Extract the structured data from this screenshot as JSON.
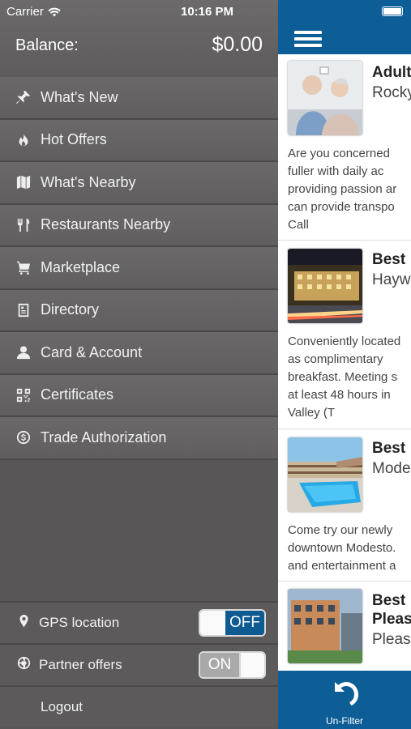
{
  "status_bar": {
    "carrier": "Carrier",
    "time": "10:16 PM"
  },
  "balance": {
    "label": "Balance:",
    "value": "$0.00"
  },
  "menu": {
    "items": [
      {
        "label": "What's New",
        "icon": "pin-icon"
      },
      {
        "label": "Hot Offers",
        "icon": "fire-icon"
      },
      {
        "label": "What's Nearby",
        "icon": "map-icon"
      },
      {
        "label": "Restaurants Nearby",
        "icon": "utensils-icon"
      },
      {
        "label": "Marketplace",
        "icon": "cart-icon"
      },
      {
        "label": "Directory",
        "icon": "directory-icon"
      },
      {
        "label": "Card & Account",
        "icon": "user-icon"
      },
      {
        "label": "Certificates",
        "icon": "qr-icon"
      },
      {
        "label": "Trade Authorization",
        "icon": "dollar-circle-icon"
      }
    ]
  },
  "settings": {
    "gps_label": "GPS location",
    "gps_state": "OFF",
    "partner_label": "Partner offers",
    "partner_state": "ON",
    "logout_label": "Logout"
  },
  "listings": [
    {
      "title": "Adult",
      "subtitle": "Rocky",
      "desc": [
        "Are you concerned",
        "fuller with daily ac",
        "providing passion ar",
        "can provide transpo",
        "Call"
      ]
    },
    {
      "title": "Best",
      "subtitle": "Hayw",
      "desc": [
        "Conveniently located",
        "as   complimentary",
        "breakfast. Meeting s",
        "at least 48 hours in",
        "Valley (T"
      ]
    },
    {
      "title": "Best",
      "subtitle": "Mode",
      "desc": [
        "Come try our newly",
        "downtown Modesto.",
        "and entertainment a"
      ]
    },
    {
      "title": "Best",
      "title2": "Pleas",
      "subtitle": "Pleasa",
      "desc": []
    }
  ],
  "tabbar": {
    "unfilter_label": "Un-Filter"
  },
  "colors": {
    "nav_blue": "#0d5e96",
    "menu_gray": "#585656",
    "toggle_blue": "#0e5a92"
  }
}
